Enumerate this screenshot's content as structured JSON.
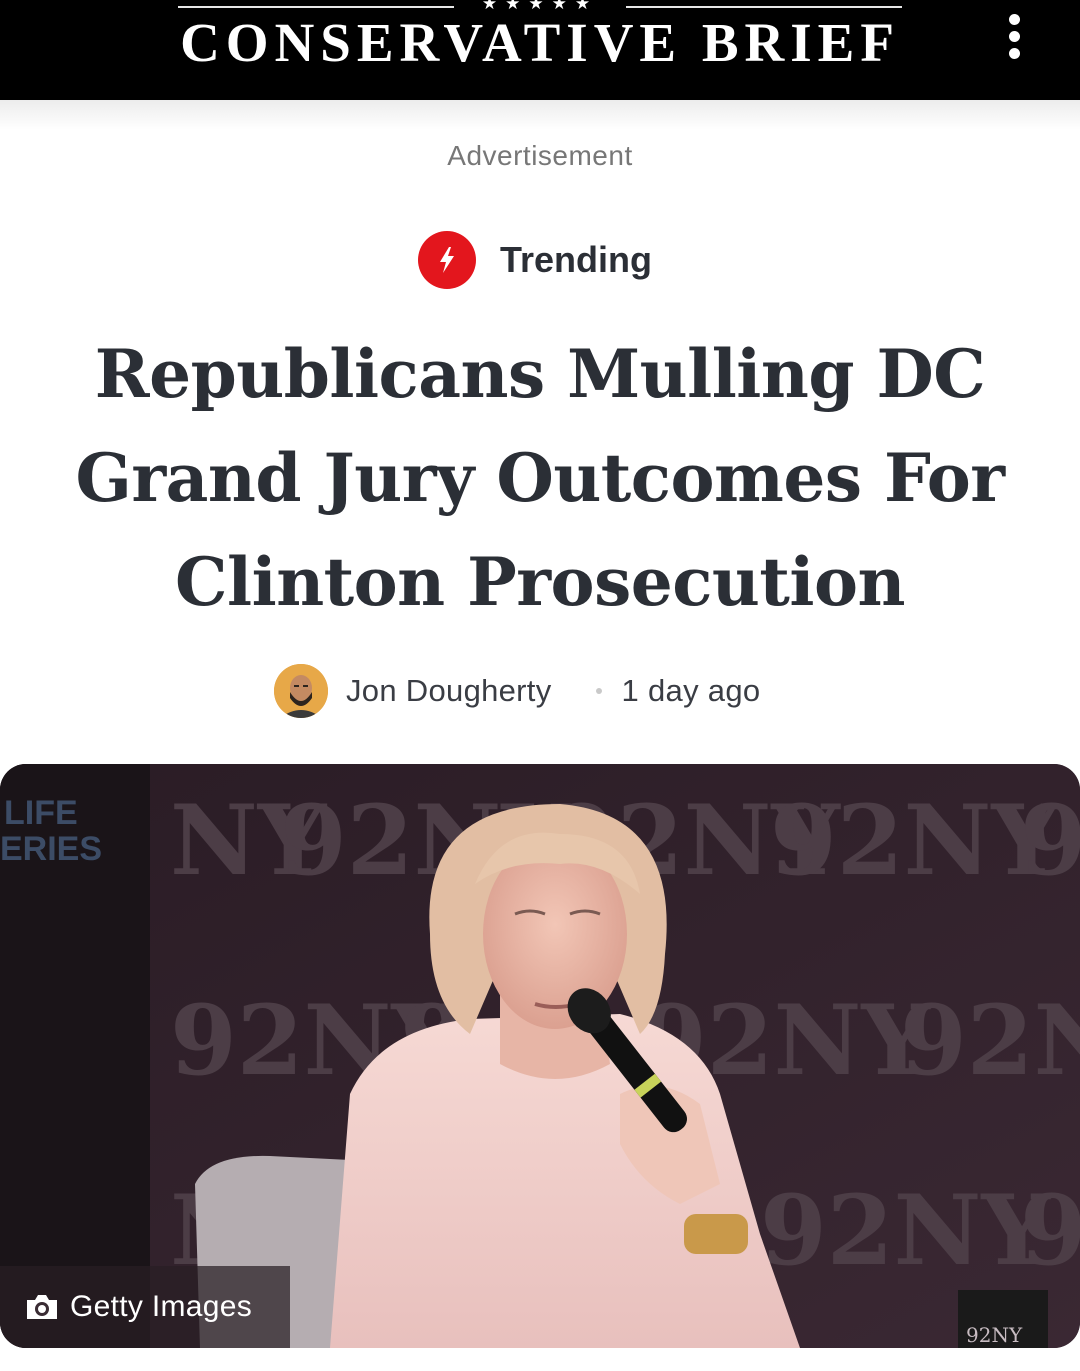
{
  "header": {
    "site_name": "CONSERVATIVE BRIEF",
    "stars": "★★★★★",
    "menu_icon": "more-vertical-icon"
  },
  "ad": {
    "label": "Advertisement"
  },
  "tag": {
    "label": "Trending",
    "icon": "lightning-icon",
    "color": "#e3161d"
  },
  "article": {
    "headline": "Republicans Mulling DC Grand Jury Outcomes For Clinton Prosecution",
    "author": "Jon Dougherty",
    "time": "1 day ago"
  },
  "image": {
    "credit": "Getty Images",
    "credit_icon": "camera-icon",
    "backdrop_text": "92NY",
    "corner_text": "LIFE\nERIES",
    "glass_label": "92NY"
  }
}
